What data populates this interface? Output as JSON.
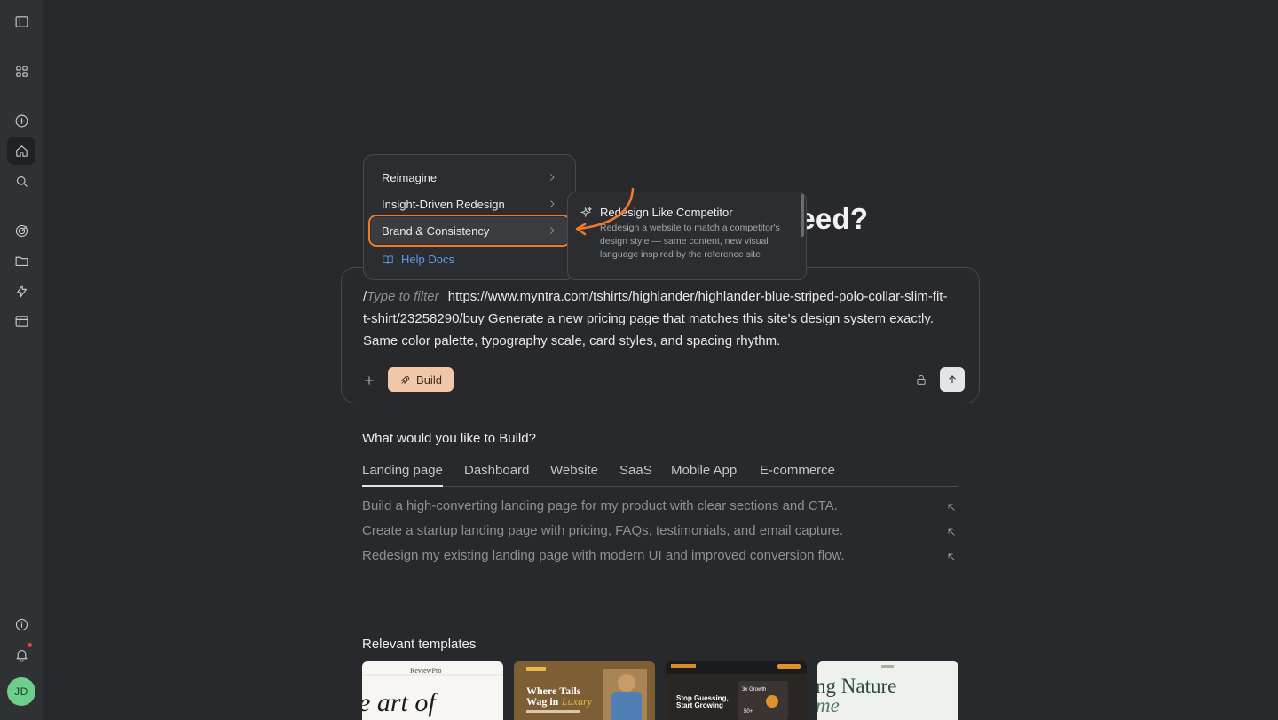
{
  "sidebar": {
    "items": [
      {
        "name": "sidebar-toggle",
        "icon": "sidebar-panel-icon"
      },
      {
        "name": "apps",
        "icon": "grid-icon"
      },
      {
        "name": "new",
        "icon": "plus-circle-icon"
      },
      {
        "name": "home",
        "icon": "home-icon",
        "active": true
      },
      {
        "name": "search",
        "icon": "search-icon"
      },
      {
        "name": "goals",
        "icon": "target-icon"
      },
      {
        "name": "projects",
        "icon": "folder-icon"
      },
      {
        "name": "automations",
        "icon": "lightning-icon"
      },
      {
        "name": "templates",
        "icon": "layout-icon"
      },
      {
        "name": "info",
        "icon": "info-icon"
      },
      {
        "name": "notifications",
        "icon": "bell-icon"
      }
    ],
    "avatar_initials": "JD"
  },
  "heading_peek": "need?",
  "menu": {
    "items": [
      {
        "label": "Reimagine"
      },
      {
        "label": "Insight-Driven Redesign"
      },
      {
        "label": "Brand & Consistency",
        "selected": true
      }
    ],
    "help_label": "Help Docs"
  },
  "submenu": {
    "title": "Redesign Like Competitor",
    "description": "Redesign a website to match a competitor's design style — same content, new visual language inspired by the reference site"
  },
  "prompt": {
    "slash": "/",
    "filter_placeholder": "Type to filter",
    "text": "https://www.myntra.com/tshirts/highlander/highlander-blue-striped-polo-collar-slim-fit-t-shirt/23258290/buy Generate a new pricing page that matches this site's design system exactly. Same color palette, typography scale, card styles, and spacing rhythm.",
    "build_label": "Build"
  },
  "build_section": {
    "question": "What would you like to Build?",
    "tabs": [
      "Landing page",
      "Dashboard",
      "Website",
      "SaaS",
      "Mobile App",
      "E-commerce"
    ],
    "active_tab": "Landing page",
    "suggestions": [
      "Build a high-converting landing page for my product with clear sections and CTA.",
      "Create a startup landing page with pricing, FAQs, testimonials, and email capture.",
      "Redesign my existing landing page with modern UI and improved conversion flow."
    ]
  },
  "templates": {
    "title": "Relevant templates",
    "cards": [
      {
        "brand": "ReviewPro",
        "headline": "e art of"
      },
      {
        "headline_1": "Where Tails",
        "headline_2": "Wag in",
        "accent": "Luxury"
      },
      {
        "headline_1": "Stop Guessing,",
        "headline_2": "Start Growing",
        "stat_1": "3x Growth",
        "stat_2": "50+"
      },
      {
        "headline_1": "ng Nature",
        "headline_2": "me"
      }
    ]
  },
  "colors": {
    "background": "#27292c",
    "sidebar": "#2f3135",
    "build_button": "#f1c7a8",
    "highlight_outline": "#f07a2a",
    "link": "#5b9cf0",
    "avatar": "#6ccf8c"
  }
}
